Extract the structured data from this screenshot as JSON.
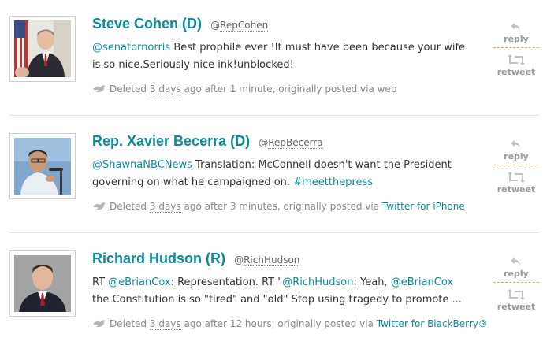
{
  "tweets": [
    {
      "name": "Steve Cohen (D)",
      "handle": "RepCohen",
      "text": [
        {
          "t": "@senatornorris",
          "link": true
        },
        {
          "t": " Best prophile ever !It must have been because your wife is so nice.Seriously nice ink!unblocked!",
          "link": false
        }
      ],
      "deleted_prefix": "Deleted",
      "ago": "3 days",
      "after": "ago after 1 minute, originally posted via",
      "client": "web",
      "client_link": false
    },
    {
      "name": "Rep. Xavier Becerra (D)",
      "handle": "RepBecerra",
      "text": [
        {
          "t": "@ShawnaNBCNews",
          "link": true
        },
        {
          "t": " Translation: McConnell doesn't want the President governing on what he campaigned on. ",
          "link": false
        },
        {
          "t": "#meetthepress",
          "link": true
        }
      ],
      "deleted_prefix": "Deleted",
      "ago": "3 days",
      "after": "ago after 3 minutes, originally posted via",
      "client": "Twitter for iPhone",
      "client_link": true
    },
    {
      "name": "Richard Hudson (R)",
      "handle": "RichHudson",
      "text": [
        {
          "t": "RT ",
          "link": false
        },
        {
          "t": "@eBrianCox",
          "link": true
        },
        {
          "t": ": Representation. RT \"",
          "link": false
        },
        {
          "t": "@RichHudson",
          "link": true
        },
        {
          "t": ": Yeah, ",
          "link": false
        },
        {
          "t": "@eBrianCox",
          "link": true
        },
        {
          "t": " the Constitution is so \"tired\" and \"old\" Stop using tragedy to promote ...",
          "link": false
        }
      ],
      "deleted_prefix": "Deleted",
      "ago": "3 days",
      "after": "ago after 12 hours, originally posted via",
      "client": "Twitter for BlackBerry®",
      "client_link": true
    }
  ],
  "actions": {
    "reply": "reply",
    "retweet": "retweet"
  },
  "colors": {
    "accent": "#0c8a9b",
    "meta": "#888888",
    "dashed": "#d9b54a"
  }
}
